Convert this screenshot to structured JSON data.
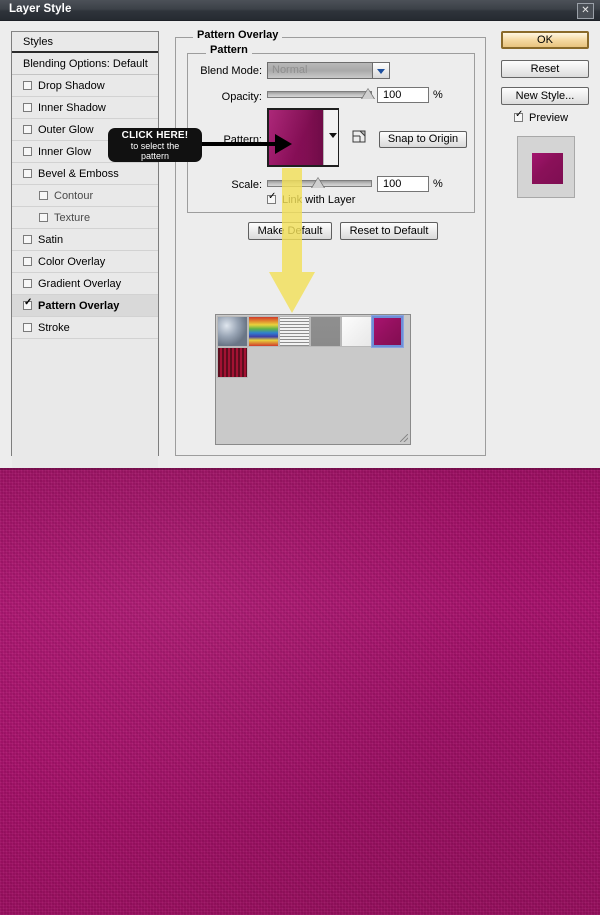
{
  "window": {
    "title": "Layer Style",
    "close_label": "✕"
  },
  "styles_panel": {
    "header": "Styles",
    "blending_options": "Blending Options: Default",
    "items": [
      {
        "label": "Drop Shadow",
        "checked": false,
        "sub": false
      },
      {
        "label": "Inner Shadow",
        "checked": false,
        "sub": false
      },
      {
        "label": "Outer Glow",
        "checked": false,
        "sub": false
      },
      {
        "label": "Inner Glow",
        "checked": false,
        "sub": false
      },
      {
        "label": "Bevel & Emboss",
        "checked": false,
        "sub": false
      },
      {
        "label": "Contour",
        "checked": false,
        "sub": true
      },
      {
        "label": "Texture",
        "checked": false,
        "sub": true
      },
      {
        "label": "Satin",
        "checked": false,
        "sub": false
      },
      {
        "label": "Color Overlay",
        "checked": false,
        "sub": false
      },
      {
        "label": "Gradient Overlay",
        "checked": false,
        "sub": false
      },
      {
        "label": "Pattern Overlay",
        "checked": true,
        "sub": false,
        "selected": true
      },
      {
        "label": "Stroke",
        "checked": false,
        "sub": false
      }
    ]
  },
  "buttons": {
    "ok": "OK",
    "reset": "Reset",
    "new_style": "New Style...",
    "preview": "Preview",
    "preview_checked": true,
    "snap_to_origin": "Snap to Origin",
    "make_default": "Make Default",
    "reset_to_default": "Reset to Default"
  },
  "pattern_overlay": {
    "group_title": "Pattern Overlay",
    "subgroup_title": "Pattern",
    "blend_mode_label": "Blend Mode:",
    "blend_mode_value": "Normal",
    "opacity_label": "Opacity:",
    "opacity_value": "100",
    "opacity_unit": "%",
    "pattern_label": "Pattern:",
    "scale_label": "Scale:",
    "scale_value": "100",
    "scale_unit": "%",
    "link_with_layer_label": "Link with Layer",
    "link_with_layer_checked": true
  },
  "pattern_picker": {
    "selected_index": 5,
    "swatches": [
      {
        "name": "bubbles-pattern",
        "css": "radial-gradient(circle at 30% 30%, #dfe6ee 0%, #9aa6b6 38%, #6a7686 70%), radial-gradient(circle at 72% 68%, #e6ecf3 0%, #8c98a8 40%, #5d6878 75%), linear-gradient(140deg, #b7c1cd 0%, #7e8a99 100%)"
      },
      {
        "name": "rainbow-pattern",
        "css": "linear-gradient(to bottom, #d03b2a 0%, #e0812f 13%, #e8d23c 27%, #5fb34a 41%, #2f7fd0 55%, #3f3fa8 68%, #e8d23c 80%, #d03b2a 100%)"
      },
      {
        "name": "horizontal-lines-pattern",
        "css": "repeating-linear-gradient(0deg, #8d8d8d 0px, #8d8d8d 1px, #f2f2f2 1px, #f2f2f2 3px)"
      },
      {
        "name": "solid-gray-pattern",
        "css": "linear-gradient(to bottom, #8f8f8f 0%, #8a8a8a 100%)"
      },
      {
        "name": "white-paper-pattern",
        "css": "linear-gradient(135deg, #fdfdfd 0%, #f1f1f1 55%, #e8e8e8 100%)"
      },
      {
        "name": "magenta-pattern",
        "css": "linear-gradient(135deg, #a8136f 0%, #93105e 50%, #820d51 100%)"
      },
      {
        "name": "dark-red-stripes-pattern",
        "css": "repeating-linear-gradient(90deg, #5d0d1e 0px, #5d0d1e 2px, #a31233 2px, #a31233 4px)"
      }
    ]
  },
  "annotation": {
    "tooltip_line1": "CLICK HERE!",
    "tooltip_line2": "to select the",
    "tooltip_line3": "pattern"
  },
  "colors": {
    "accent_magenta": "#a8116b",
    "pattern_swatch": "#9b0e5e",
    "ok_button": "#f5d9a2",
    "tooltip_bg": "#111111",
    "yellow_arrow": "#f2e05a"
  }
}
